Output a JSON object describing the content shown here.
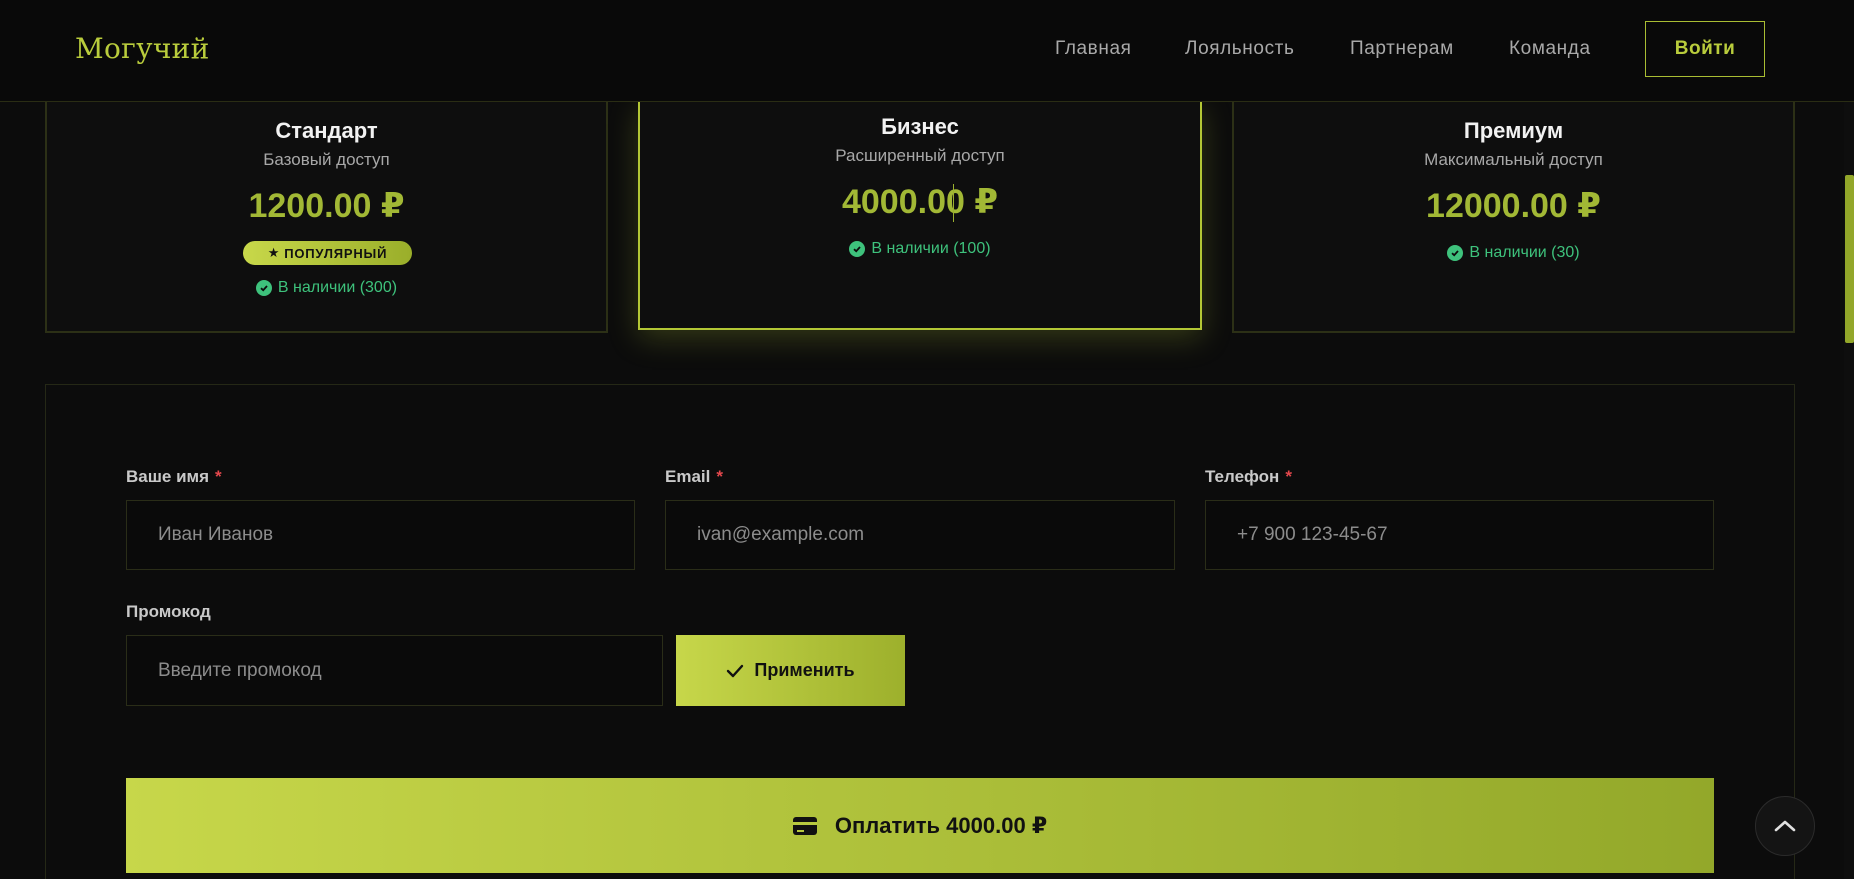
{
  "header": {
    "logo": "Могучий",
    "nav": [
      "Главная",
      "Лояльность",
      "Партнерам",
      "Команда"
    ],
    "login": "Войти"
  },
  "plans": [
    {
      "name": "Стандарт",
      "sub": "Базовый доступ",
      "price": "1200.00 ₽",
      "badge": "ПОПУЛЯРНЫЙ",
      "badge_icon": "★",
      "stock": "В наличии (300)"
    },
    {
      "name": "Бизнес",
      "sub": "Расширенный доступ",
      "price": "4000.00 ₽",
      "stock": "В наличии (100)",
      "selected": true
    },
    {
      "name": "Премиум",
      "sub": "Максимальный доступ",
      "price": "12000.00 ₽",
      "stock": "В наличии (30)"
    }
  ],
  "form": {
    "name_label": "Ваше имя",
    "name_placeholder": "Иван Иванов",
    "email_label": "Email",
    "email_placeholder": "ivan@example.com",
    "phone_label": "Телефон",
    "phone_placeholder": "+7 900 123-45-67",
    "required_mark": "*",
    "promo_label": "Промокод",
    "promo_placeholder": "Введите промокод",
    "apply_label": "Применить",
    "pay_label": "Оплатить 4000.00 ₽"
  },
  "colors": {
    "accent": "#b9cc3c",
    "success": "#3ec27c",
    "required": "#e5484d",
    "background": "#0c0c0c"
  },
  "icons": {
    "stock": "check-circle-icon",
    "apply": "checkmark-icon",
    "pay": "credit-card-icon",
    "scroll_top": "chevron-up-icon"
  }
}
